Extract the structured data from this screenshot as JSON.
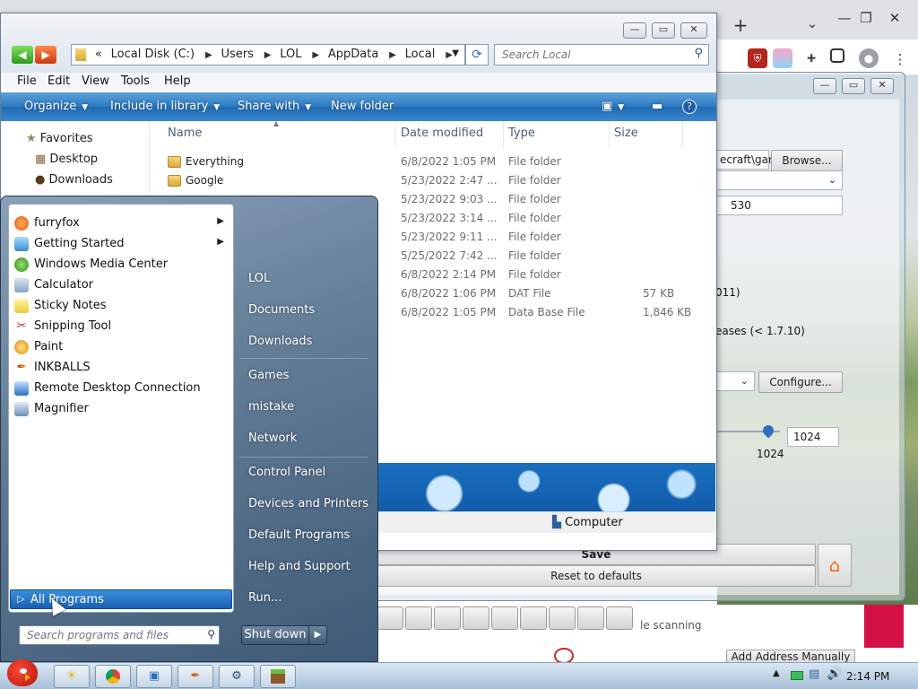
{
  "browser": {
    "new_tab_symbol": "+",
    "tab_list_symbol": "⌄",
    "min_symbol": "—",
    "restore_symbol": "❐",
    "close_symbol": "✕",
    "menu_symbol": "⋮"
  },
  "launcher": {
    "min_symbol": "—",
    "max_symbol": "▭",
    "close_symbol": "✕",
    "path_value": "ecraft\\gar",
    "browse_label": "Browse...",
    "memory_value": "530",
    "partial_label_1": "011)",
    "partial_label_2": "eases (< 1.7.10)",
    "configure_label": "Configure...",
    "resolution_value": "1024",
    "slider_label": "1024",
    "save_label": "Save",
    "reset_label": "Reset to defaults",
    "scanning_text": "le scanning",
    "add_address_label": "Add Address Manually"
  },
  "explorer": {
    "min_symbol": "—",
    "max_symbol": "▭",
    "close_symbol": "✕",
    "breadcrumb": [
      "«",
      "Local Disk (C:)",
      "Users",
      "LOL",
      "AppData",
      "Local"
    ],
    "search_placeholder": "Search Local",
    "menu": [
      "File",
      "Edit",
      "View",
      "Tools",
      "Help"
    ],
    "commands": {
      "organize": "Organize",
      "include": "Include in library",
      "share": "Share with",
      "new_folder": "New folder"
    },
    "nav": {
      "favorites": "Favorites",
      "desktop": "Desktop",
      "downloads": "Downloads"
    },
    "columns": {
      "name": "Name",
      "date": "Date modified",
      "type": "Type",
      "size": "Size"
    },
    "files": [
      {
        "name": "Everything",
        "date": "6/8/2022 1:05 PM",
        "type": "File folder",
        "size": ""
      },
      {
        "name": "Google",
        "date": "5/23/2022 2:47 ...",
        "type": "File folder",
        "size": ""
      },
      {
        "name": "",
        "date": "5/23/2022 9:03 ...",
        "type": "File folder",
        "size": ""
      },
      {
        "name": "",
        "date": "5/23/2022 3:14 ...",
        "type": "File folder",
        "size": ""
      },
      {
        "name": "",
        "date": "5/23/2022 9:11 ...",
        "type": "File folder",
        "size": ""
      },
      {
        "name": "",
        "date": "5/25/2022 7:42 ...",
        "type": "File folder",
        "size": ""
      },
      {
        "name": "",
        "date": "6/8/2022 2:14 PM",
        "type": "File folder",
        "size": ""
      },
      {
        "name": "",
        "date": "6/8/2022 1:06 PM",
        "type": "DAT File",
        "size": "57 KB"
      },
      {
        "name": "",
        "date": "6/8/2022 1:05 PM",
        "type": "Data Base File",
        "size": "1,846 KB"
      }
    ],
    "status_computer": "Computer"
  },
  "start_menu": {
    "programs": [
      {
        "label": "furryfox",
        "arrow": "▶"
      },
      {
        "label": "Getting Started",
        "arrow": "▶"
      },
      {
        "label": "Windows Media Center",
        "arrow": ""
      },
      {
        "label": "Calculator",
        "arrow": ""
      },
      {
        "label": "Sticky Notes",
        "arrow": ""
      },
      {
        "label": "Snipping Tool",
        "arrow": ""
      },
      {
        "label": "Paint",
        "arrow": ""
      },
      {
        "label": "INKBALLS",
        "arrow": ""
      },
      {
        "label": "Remote Desktop Connection",
        "arrow": ""
      },
      {
        "label": "Magnifier",
        "arrow": ""
      }
    ],
    "all_programs": "All Programs",
    "search_placeholder": "Search programs and files",
    "right_links": [
      "LOL",
      "Documents",
      "Downloads",
      "Games",
      "mistake",
      "Network",
      "Control Panel",
      "Devices and Printers",
      "Default Programs",
      "Help and Support",
      "Run..."
    ],
    "shutdown_label": "Shut down"
  },
  "taskbar": {
    "clock": "2:14 PM"
  }
}
